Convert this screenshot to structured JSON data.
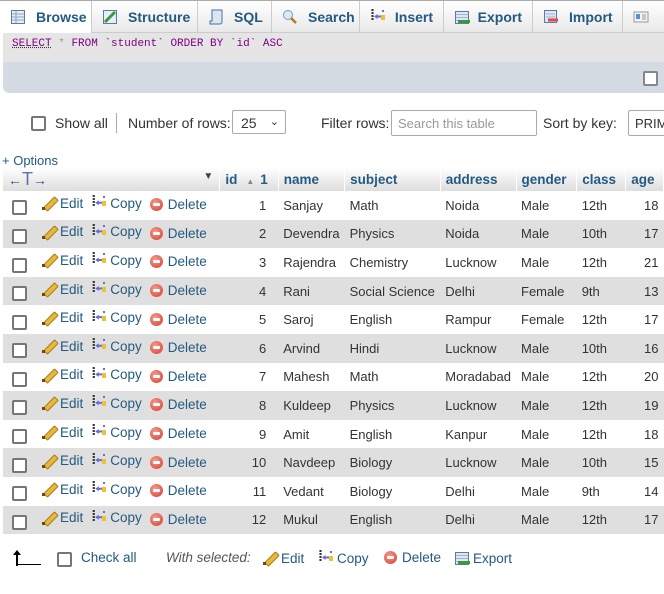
{
  "tabs": [
    {
      "label": "Browse",
      "icon": "browse-icon",
      "active": true
    },
    {
      "label": "Structure",
      "icon": "structure-icon",
      "active": false
    },
    {
      "label": "SQL",
      "icon": "sql-icon",
      "active": false
    },
    {
      "label": "Search",
      "icon": "search-icon",
      "active": false
    },
    {
      "label": "Insert",
      "icon": "insert-icon",
      "active": false
    },
    {
      "label": "Export",
      "icon": "export-icon",
      "active": false
    },
    {
      "label": "Import",
      "icon": "import-icon",
      "active": false
    },
    {
      "label": "",
      "icon": "privileges-icon",
      "active": false
    }
  ],
  "sql": {
    "select": "SELECT",
    "star": "*",
    "rest": "FROM `student` ORDER BY `id` ASC"
  },
  "controls": {
    "show_all_label": "Show all",
    "number_of_rows_label": "Number of rows:",
    "number_of_rows_value": "25",
    "filter_label": "Filter rows:",
    "filter_placeholder": "Search this table",
    "sort_label": "Sort by key:",
    "sort_value": "PRIM"
  },
  "options_link": "+ Options",
  "table": {
    "arrows_label": "←T→",
    "sort_indicator": "1",
    "columns": [
      "id",
      "name",
      "subject",
      "address",
      "gender",
      "class",
      "age"
    ],
    "actions": {
      "edit": "Edit",
      "copy": "Copy",
      "delete": "Delete"
    },
    "rows": [
      {
        "id": "1",
        "name": "Sanjay",
        "subject": "Math",
        "address": "Noida",
        "gender": "Male",
        "class": "12th",
        "age": "18"
      },
      {
        "id": "2",
        "name": "Devendra",
        "subject": "Physics",
        "address": "Noida",
        "gender": "Male",
        "class": "10th",
        "age": "17"
      },
      {
        "id": "3",
        "name": "Rajendra",
        "subject": "Chemistry",
        "address": "Lucknow",
        "gender": "Male",
        "class": "12th",
        "age": "21"
      },
      {
        "id": "4",
        "name": "Rani",
        "subject": "Social Science",
        "address": "Delhi",
        "gender": "Female",
        "class": "9th",
        "age": "13"
      },
      {
        "id": "5",
        "name": "Saroj",
        "subject": "English",
        "address": "Rampur",
        "gender": "Female",
        "class": "12th",
        "age": "17"
      },
      {
        "id": "6",
        "name": "Arvind",
        "subject": "Hindi",
        "address": "Lucknow",
        "gender": "Male",
        "class": "10th",
        "age": "16"
      },
      {
        "id": "7",
        "name": "Mahesh",
        "subject": "Math",
        "address": "Moradabad",
        "gender": "Male",
        "class": "12th",
        "age": "20"
      },
      {
        "id": "8",
        "name": "Kuldeep",
        "subject": "Physics",
        "address": "Lucknow",
        "gender": "Male",
        "class": "12th",
        "age": "19"
      },
      {
        "id": "9",
        "name": "Amit",
        "subject": "English",
        "address": "Kanpur",
        "gender": "Male",
        "class": "12th",
        "age": "18"
      },
      {
        "id": "10",
        "name": "Navdeep",
        "subject": "Biology",
        "address": "Lucknow",
        "gender": "Male",
        "class": "10th",
        "age": "15"
      },
      {
        "id": "11",
        "name": "Vedant",
        "subject": "Biology",
        "address": "Delhi",
        "gender": "Male",
        "class": "9th",
        "age": "14"
      },
      {
        "id": "12",
        "name": "Mukul",
        "subject": "English",
        "address": "Delhi",
        "gender": "Male",
        "class": "12th",
        "age": "17"
      }
    ]
  },
  "footer": {
    "check_all": "Check all",
    "with_selected": "With selected:",
    "edit": "Edit",
    "copy": "Copy",
    "delete": "Delete",
    "export": "Export"
  },
  "colors": {
    "link": "#235a81",
    "sql_keyword": "#800080",
    "row_alt": "#dfdfdf",
    "sql_bar": "#d4dbe3"
  }
}
